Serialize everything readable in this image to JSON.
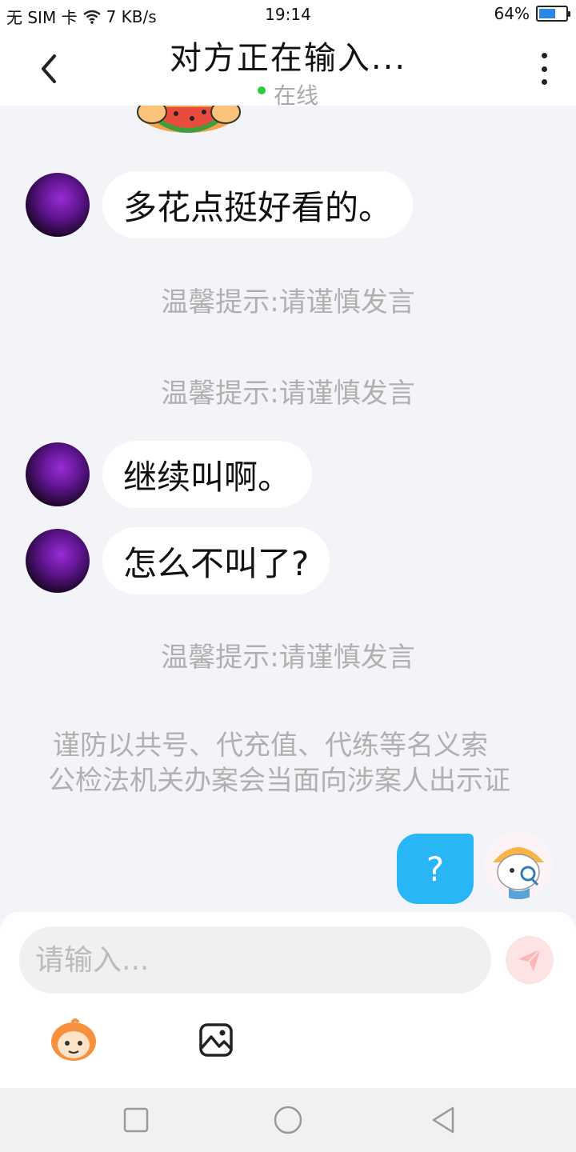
{
  "status_bar": {
    "carrier": "无 SIM 卡",
    "speed": "7 KB/s",
    "time": "19:14",
    "battery": "64%",
    "battery_level": 0.64
  },
  "header": {
    "title": "对方正在输入...",
    "status": "在线",
    "status_color": "#2ecc40"
  },
  "messages": [
    {
      "type": "incoming",
      "text": "多花点挺好看的。"
    },
    {
      "type": "system",
      "text": "温馨提示:请谨慎发言"
    },
    {
      "type": "system",
      "text": "温馨提示:请谨慎发言"
    },
    {
      "type": "incoming",
      "text": "继续叫啊。"
    },
    {
      "type": "incoming",
      "text": "怎么不叫了?"
    },
    {
      "type": "system",
      "text": "温馨提示:请谨慎发言"
    },
    {
      "type": "notice",
      "line1": "谨防以共号、代充值、代练等名义索",
      "line2": "公检法机关办案会当面向涉案人出示证"
    },
    {
      "type": "outgoing",
      "text": "?"
    }
  ],
  "input": {
    "placeholder": "请输入..."
  },
  "colors": {
    "accent": "#29b6f6",
    "background": "#f3f4f7"
  },
  "icons": [
    "back-icon",
    "more-icon",
    "send-icon",
    "emoji-icon",
    "image-icon",
    "square-nav-icon",
    "circle-nav-icon",
    "triangle-nav-icon"
  ]
}
